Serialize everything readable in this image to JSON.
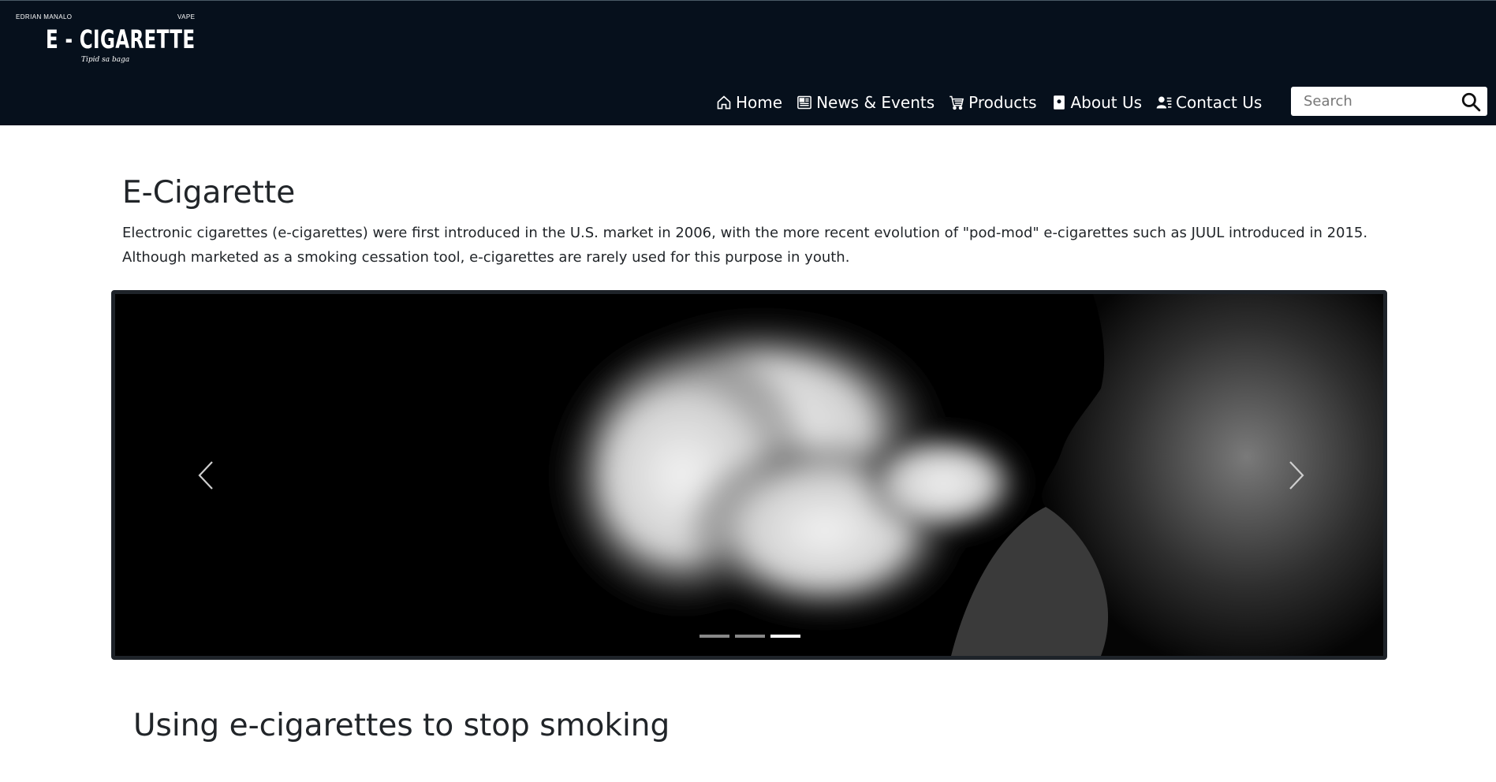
{
  "brand": {
    "top_left": "EDRIAN MANALO",
    "top_right": "VAPE",
    "logo_text": "E - CIGARETTE",
    "tagline": "Tipid sa baga"
  },
  "nav": {
    "items": [
      {
        "label": "Home",
        "icon": "home-icon"
      },
      {
        "label": "News & Events",
        "icon": "newspaper-icon"
      },
      {
        "label": "Products",
        "icon": "cart-icon"
      },
      {
        "label": "About Us",
        "icon": "person-badge-icon"
      },
      {
        "label": "Contact Us",
        "icon": "person-lines-icon"
      }
    ]
  },
  "search": {
    "placeholder": "Search",
    "value": "",
    "icon": "search-icon"
  },
  "main": {
    "title": "E-Cigarette",
    "intro": "Electronic cigarettes (e-cigarettes) were first introduced in the U.S. market in 2006, with the more recent evolution of \"pod-mod\" e-cigarettes such as JUUL introduced in 2015. Although marketed as a smoking cessation tool, e-cigarettes are rarely used for this purpose in youth.",
    "carousel": {
      "slide_count": 3,
      "active_index": 2,
      "prev_icon": "chevron-left-icon",
      "next_icon": "chevron-right-icon"
    },
    "section_title": "Using e-cigarettes to stop smoking"
  },
  "colors": {
    "navbar_bg": "#06101c",
    "page_bg": "#ffffff",
    "text": "#212529",
    "carousel_border": "#1e2329"
  }
}
